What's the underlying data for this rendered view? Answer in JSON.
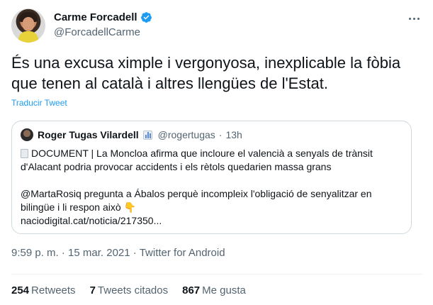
{
  "author": {
    "name": "Carme Forcadell",
    "handle": "@ForcadellCarme"
  },
  "tweet": {
    "text": "És una excusa ximple i vergonyosa, inexplicable la fòbia que tenen al català i altres llengües de l'Estat.",
    "translate_label": "Traducir Tweet"
  },
  "quoted": {
    "name": "Roger Tugas Vilardell",
    "handle": "@rogertugas",
    "separator": "·",
    "time": "13h",
    "line1": "DOCUMENT | La Moncloa afirma que incloure el valencià a senyals de trànsit d'Alacant podria provocar accidents i els rètols quedarien massa grans",
    "line2": "@MartaRosiq pregunta a Ábalos perquè incompleix l'obligació de senyalitzar en bilingüe i li respon això",
    "link": "naciodigital.cat/noticia/217350..."
  },
  "meta": {
    "time": "9:59 p. m.",
    "separator1": "·",
    "date": "15 mar. 2021",
    "separator2": "·",
    "source": "Twitter for Android"
  },
  "stats": {
    "retweets_count": "254",
    "retweets_label": "Retweets",
    "quotes_count": "7",
    "quotes_label": "Tweets citados",
    "likes_count": "867",
    "likes_label": "Me gusta"
  },
  "colors": {
    "accent": "#1d9bf0",
    "text": "#0f1419",
    "secondary": "#536471",
    "border": "#cfd9de"
  },
  "icons": {
    "verified": "verified-badge-icon",
    "more": "more-options-icon",
    "document": "page-icon",
    "chart": "bar-chart-emoji-icon",
    "pointing": "pointing-down-icon"
  }
}
